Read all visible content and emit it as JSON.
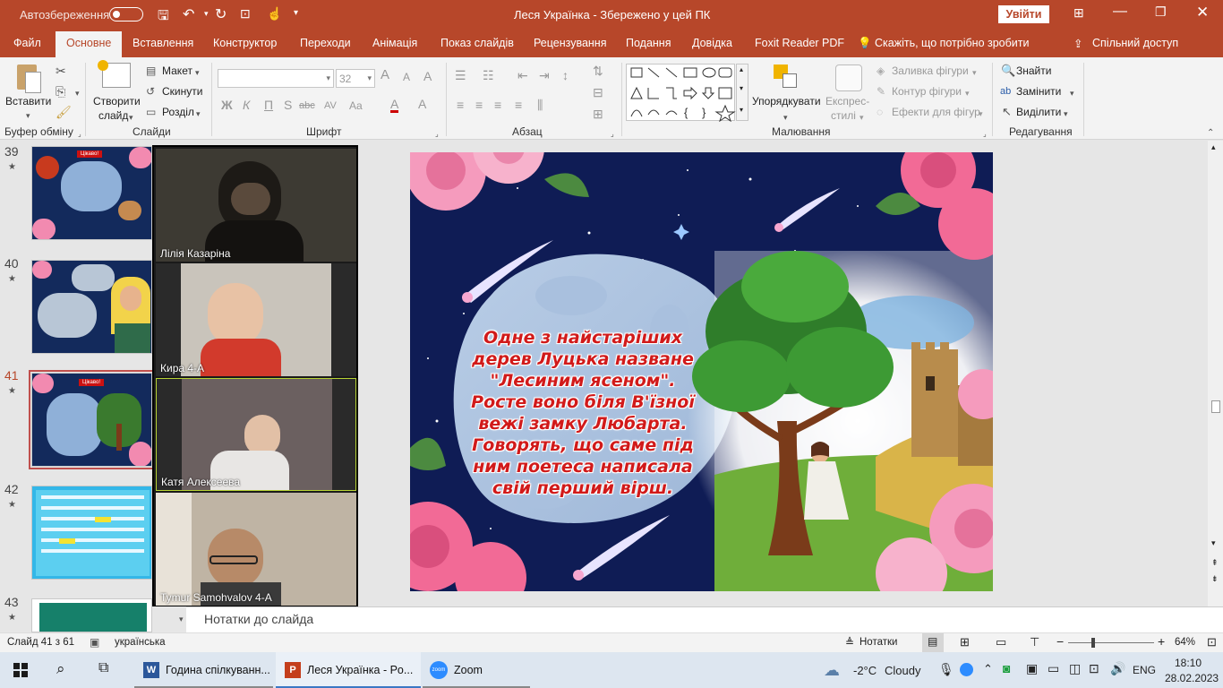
{
  "titlebar": {
    "autosave_label": "Автозбереження",
    "autosave_state": "Вимк",
    "doc_title": "Леся Українка  -  Збережено у цей ПК",
    "signin_button": "Увійти"
  },
  "tabs": [
    {
      "label": "Файл"
    },
    {
      "label": "Основне"
    },
    {
      "label": "Вставлення"
    },
    {
      "label": "Конструктор"
    },
    {
      "label": "Переходи"
    },
    {
      "label": "Анімація"
    },
    {
      "label": "Показ слайдів"
    },
    {
      "label": "Рецензування"
    },
    {
      "label": "Подання"
    },
    {
      "label": "Довідка"
    },
    {
      "label": "Foxit Reader PDF"
    },
    {
      "label": "Скажіть, що потрібно зробити"
    },
    {
      "label": "Спільний доступ"
    }
  ],
  "ribbon": {
    "paste": "Вставити",
    "clipboard_group": "Буфер обміну",
    "new_slide_line1": "Створити",
    "new_slide_line2": "слайд",
    "layout": "Макет",
    "reset": "Скинути",
    "section": "Розділ",
    "slides_group": "Слайди",
    "font_name": "",
    "font_size": "32",
    "font_group": "Шрифт",
    "bold": "Ж",
    "italic": "К",
    "underline": "П",
    "shadow": "S",
    "strike": "abc",
    "spacing": "AV",
    "case": "Aa",
    "font_color": "A",
    "paragraph_group": "Абзац",
    "arrange_line1": "Упорядкувати",
    "quick_styles_line1": "Експрес-",
    "quick_styles_line2": "стилі",
    "shape_fill": "Заливка фігури",
    "shape_outline": "Контур фігури",
    "shape_effects": "Ефекти для фігур",
    "drawing_group": "Малювання",
    "find": "Знайти",
    "replace": "Замінити",
    "select": "Виділити",
    "editing_group": "Редагування"
  },
  "thumbnails": [
    {
      "num": "39",
      "active": false
    },
    {
      "num": "40",
      "active": false
    },
    {
      "num": "41",
      "active": true
    },
    {
      "num": "42",
      "active": false
    },
    {
      "num": "43",
      "active": false
    }
  ],
  "thumb_texts": {
    "t39": "Цікаво!",
    "t41": "Цікаво!"
  },
  "zoom_participants": [
    {
      "name": "Лілія Казаріна"
    },
    {
      "name": "Кира 4-А"
    },
    {
      "name": "Катя Алексеева"
    },
    {
      "name": "Tymur Samohvalov 4-A"
    }
  ],
  "slide": {
    "text": "Одне з найстаріших дерев Луцька назване \"Лесиним ясеном\". Росте воно біля В'їзної вежі замку Любарта. Говорять, що саме під ним поетеса написала свій перший вірш."
  },
  "notes_placeholder": "Нотатки до слайда",
  "status": {
    "slide_counter": "Слайд 41 з 61",
    "language": "українська",
    "notes_button": "Нотатки",
    "zoom": "64%"
  },
  "taskbar": {
    "apps": [
      {
        "label": "Година спілкуванн..."
      },
      {
        "label": "Леся Українка - Po..."
      },
      {
        "label": "Zoom"
      }
    ],
    "weather_temp": "-2°C",
    "weather_desc": "Cloudy",
    "lang": "ENG",
    "time": "18:10",
    "date": "28.02.2023"
  },
  "colors": {
    "accent": "#b7472a",
    "slide_bg": "#0d1a4a",
    "slide_text": "#d11a1a"
  }
}
